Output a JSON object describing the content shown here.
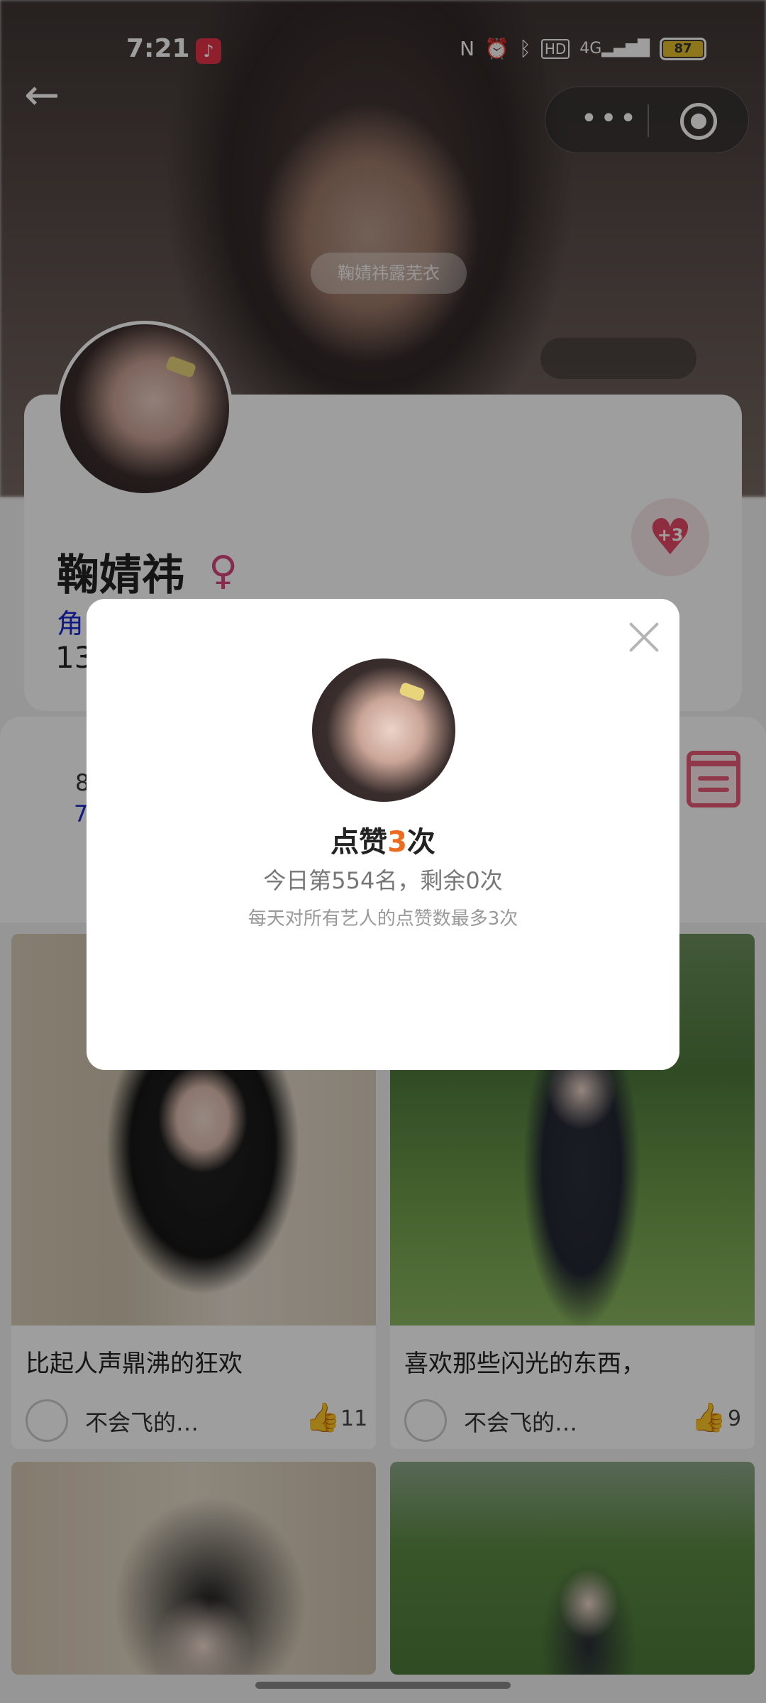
{
  "status_bar": {
    "time": "7:21",
    "battery": "87",
    "icons": [
      "nfc-icon",
      "alarm-icon",
      "bluetooth-icon",
      "hd-icon",
      "4g-signal-icon"
    ]
  },
  "nav": {
    "back_icon": "back-arrow-icon",
    "more_icon": "more-dots-icon",
    "close_target_icon": "target-icon"
  },
  "hero": {
    "tag": "鞠婧祎露芜衣"
  },
  "profile": {
    "name": "鞠婧祎",
    "gender_symbol": "♀",
    "role_text_visible": "角",
    "count_text_visible": "13",
    "like_badge": "+3"
  },
  "stats": {
    "line_a": "8",
    "line_b": "7"
  },
  "posts": [
    {
      "caption": "比起人声鼎沸的狂欢",
      "author": "不会飞的…",
      "likes": "11"
    },
    {
      "caption": "喜欢那些闪光的东西，",
      "author": "不会飞的…",
      "likes": "9"
    }
  ],
  "dialog": {
    "title_prefix": "点赞",
    "title_count": "3",
    "title_suffix": "次",
    "subtitle": "今日第554名，剩余0次",
    "note": "每天对所有艺人的点赞数最多3次"
  },
  "colors": {
    "accent_orange": "#ee6a1e",
    "heart_pink": "#e64a66",
    "link_blue": "#1a2bd0",
    "battery_yellow": "#e5c02a"
  }
}
